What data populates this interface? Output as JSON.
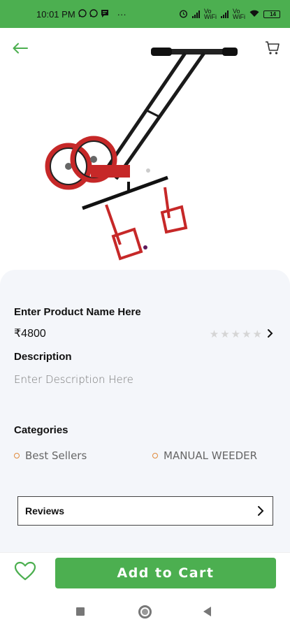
{
  "status_bar": {
    "time": "10:01 PM",
    "notification_icons": [
      "whatsapp-icon",
      "whatsapp-icon",
      "message-icon"
    ],
    "overflow": "···",
    "volte1": "Vo WiFi",
    "volte2": "Vo WiFi",
    "battery": "14"
  },
  "header": {
    "back_icon": "arrow-left-icon",
    "cart_icon": "cart-icon",
    "accent_color": "#4caf50"
  },
  "product": {
    "name": "Enter Product Name Here",
    "price": "₹4800",
    "rating_stars": [
      "★",
      "★",
      "★",
      "★",
      "★"
    ],
    "rating_value": 0
  },
  "description": {
    "heading": "Description",
    "text": "Enter Description Here"
  },
  "categories": {
    "heading": "Categories",
    "items": [
      "Best Sellers",
      "MANUAL WEEDER"
    ]
  },
  "reviews": {
    "label": "Reviews"
  },
  "actions": {
    "add_to_cart": "Add to Cart",
    "favorite_icon": "heart-icon"
  }
}
